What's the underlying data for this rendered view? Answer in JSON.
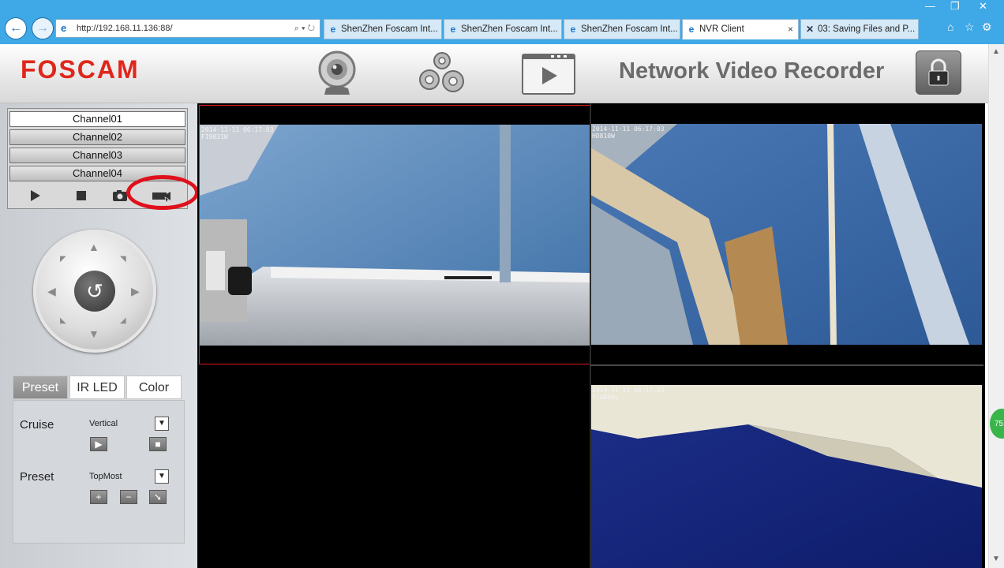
{
  "browser": {
    "url": "http://192.168.11.136:88/",
    "url_controls": "⌕ ▾ ↻",
    "tabs": [
      {
        "label": "ShenZhen Foscam Int..."
      },
      {
        "label": "ShenZhen Foscam Int..."
      },
      {
        "label": "ShenZhen Foscam Int..."
      },
      {
        "label": "NVR Client",
        "active": true
      },
      {
        "label": "03: Saving Files and P..."
      }
    ],
    "tab_close": "×"
  },
  "header": {
    "logo": "FOSCAM",
    "title": "Network Video Recorder",
    "icons": [
      "webcam-icon",
      "settings-gears-icon",
      "playback-icon",
      "lock-icon"
    ]
  },
  "sidebar": {
    "channels": [
      "Channel01",
      "Channel02",
      "Channel03",
      "Channel04"
    ],
    "controls": [
      "play-icon",
      "stop-icon",
      "snapshot-icon",
      "record-icon"
    ],
    "tabs": [
      {
        "label": "Preset",
        "active": true
      },
      {
        "label": "IR LED"
      },
      {
        "label": "Color"
      }
    ],
    "cruise": {
      "label": "Cruise",
      "value": "Vertical"
    },
    "preset": {
      "label": "Preset",
      "value": "TopMost"
    }
  },
  "videos": [
    {
      "osd_time": "2014-11-11 06:17:03",
      "osd_name": "FI9831W"
    },
    {
      "osd_time": "2014-11-11 06:17:03",
      "osd_name": "HD810W"
    },
    {
      "osd_time": "",
      "osd_name": ""
    },
    {
      "osd_time": "2014-11-11 06:17:03",
      "osd_name": "PlaBaby"
    }
  ],
  "side_badge": "75",
  "colors": {
    "brand": "#e0261b",
    "chrome": "#3fa8e6",
    "selection": "#e01818"
  }
}
